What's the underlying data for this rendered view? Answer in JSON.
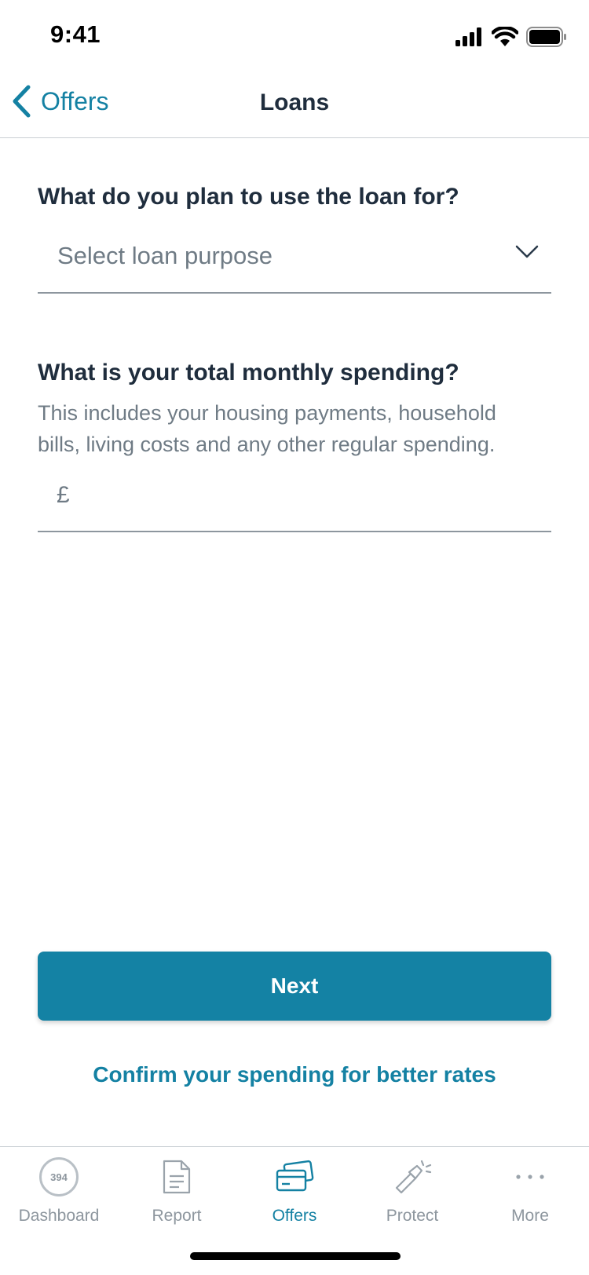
{
  "status_bar": {
    "time": "9:41",
    "icons": [
      "signal-icon",
      "wifi-icon",
      "battery-icon"
    ]
  },
  "nav": {
    "back_label": "Offers",
    "title": "Loans"
  },
  "form": {
    "loan_purpose": {
      "question": "What do you plan to use the loan for?",
      "selected_value": "Select loan purpose"
    },
    "monthly_spending": {
      "question": "What is your total monthly spending?",
      "helper": "This includes your housing payments, household bills, living costs and any other regular spending.",
      "currency_symbol": "£",
      "value": ""
    }
  },
  "actions": {
    "next_label": "Next",
    "confirm_link": "Confirm your spending for better rates"
  },
  "tab_bar": {
    "active": "Offers",
    "score": "394",
    "items": [
      {
        "label": "Dashboard",
        "icon": "credit-score-icon"
      },
      {
        "label": "Report",
        "icon": "document-icon"
      },
      {
        "label": "Offers",
        "icon": "cards-icon"
      },
      {
        "label": "Protect",
        "icon": "flashlight-icon"
      },
      {
        "label": "More",
        "icon": "more-dots-icon"
      }
    ]
  },
  "colors": {
    "accent": "#1481a3",
    "button": "#1482a4",
    "heading": "#1f2d3d",
    "muted": "#6f7b85",
    "divider": "#c9ced3"
  }
}
